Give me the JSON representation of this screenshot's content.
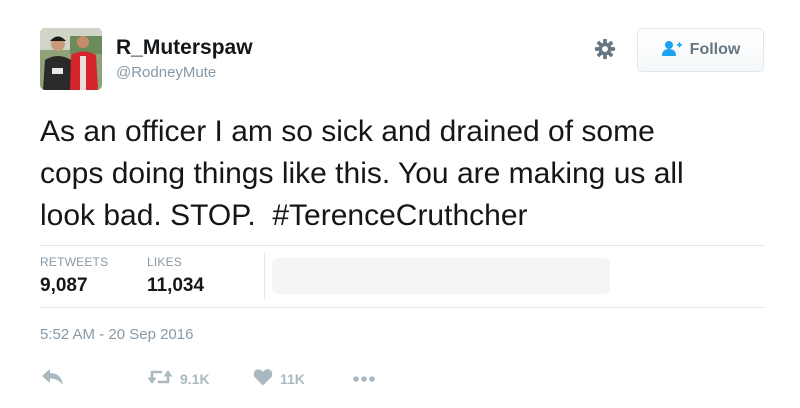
{
  "user": {
    "display_name": "R_Muterspaw",
    "handle": "@RodneyMute"
  },
  "follow_button": {
    "label": "Follow"
  },
  "tweet": {
    "text": "As an officer I am so sick and drained of some\ncops doing things like this. You are making us all\nlook bad. STOP.  #TerenceCruthcher"
  },
  "stats": {
    "retweets_label": "RETWEETS",
    "retweets_value": "9,087",
    "likes_label": "LIKES",
    "likes_value": "11,034"
  },
  "timestamp": "5:52 AM - 20 Sep 2016",
  "actions": {
    "retweet_count": "9.1K",
    "like_count": "11K"
  },
  "icons": {
    "settings": "gear-icon",
    "follow": "add-user-icon",
    "reply": "reply-icon",
    "retweet": "retweet-icon",
    "like": "heart-icon",
    "more": "more-icon"
  },
  "colors": {
    "text": "#14171a",
    "muted": "#8899a6",
    "icon": "#aab8c2",
    "follow_icon": "#1da1f2",
    "border": "#e1e8ed"
  }
}
